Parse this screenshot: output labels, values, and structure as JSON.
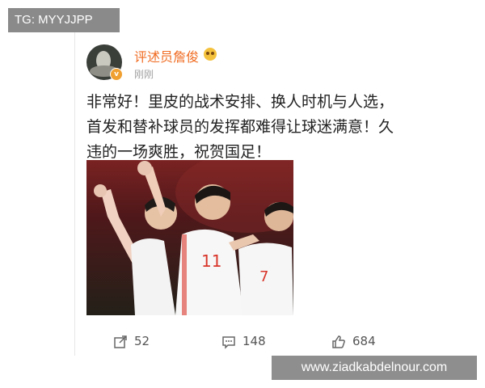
{
  "overlay": {
    "tag_text": "TG: MYYJJPP",
    "watermark_text": "www.ziadkabdelnour.com"
  },
  "post": {
    "username": "评述员詹俊",
    "timestamp": "刚刚",
    "verified_badge": "v",
    "text": "非常好！里皮的战术安排、换人时机与人选，首发和替补球员的发挥都难得让球迷满意！久违的一场爽胜，祝贺国足！",
    "image": {
      "jersey_numbers": [
        "11",
        "7"
      ]
    }
  },
  "actions": {
    "repost_count": "52",
    "comment_count": "148",
    "like_count": "684"
  },
  "colors": {
    "username": "#f06d24",
    "badge": "#f0a030",
    "jersey_red": "#d8352a"
  }
}
